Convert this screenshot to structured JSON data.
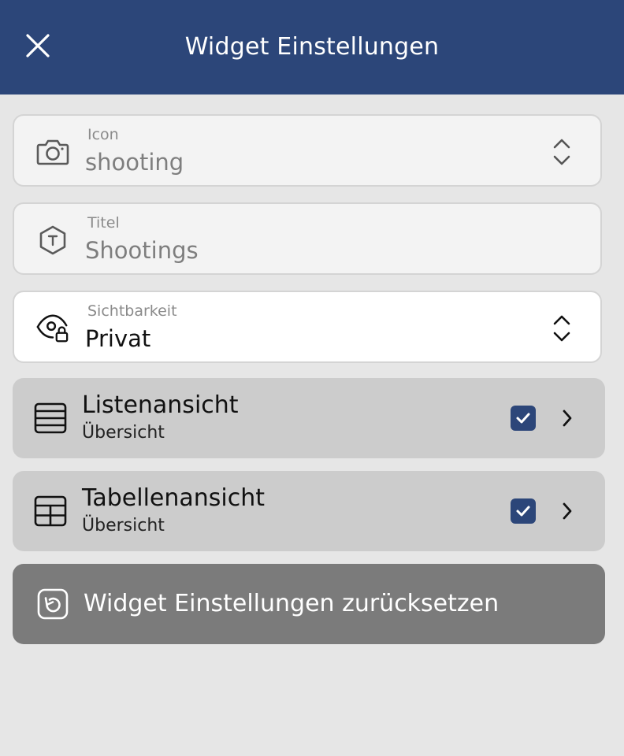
{
  "header": {
    "title": "Widget Einstellungen",
    "close_icon": "close-icon"
  },
  "fields": {
    "icon": {
      "label": "Icon",
      "value": "shooting",
      "icon": "camera-icon"
    },
    "title": {
      "label": "Titel",
      "value": "Shootings",
      "icon": "title-hexagon-icon"
    },
    "visibility": {
      "label": "Sichtbarkeit",
      "value": "Privat",
      "icon": "eye-lock-icon"
    }
  },
  "views": [
    {
      "title": "Listenansicht",
      "subtitle": "Übersicht",
      "checked": true,
      "icon": "list-view-icon"
    },
    {
      "title": "Tabellenansicht",
      "subtitle": "Übersicht",
      "checked": true,
      "icon": "table-view-icon"
    }
  ],
  "reset": {
    "label": "Widget Einstellungen zurücksetzen",
    "icon": "reset-icon"
  },
  "colors": {
    "header_bg": "#2c4679",
    "page_bg": "#e6e6e6",
    "checkbox": "#2c4679",
    "row_bg": "#cccccc",
    "reset_bg": "#7b7b7b"
  }
}
